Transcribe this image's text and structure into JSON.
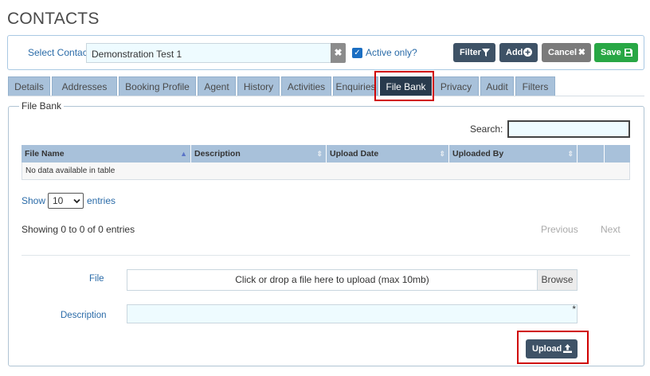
{
  "page": {
    "title": "CONTACTS"
  },
  "contact_bar": {
    "select_label": "Select Contact",
    "contact_value": "Demonstration Test 1",
    "clear_icon": "close-icon",
    "active_only_label": "Active only?",
    "active_only_checked": true,
    "buttons": {
      "filter": "Filter",
      "add": "Add",
      "cancel": "Cancel",
      "save": "Save"
    },
    "colors": {
      "dark": "#3e5266",
      "grey": "#7b7b7b",
      "green": "#28a745"
    }
  },
  "tabs": [
    {
      "label": "Details"
    },
    {
      "label": "Addresses"
    },
    {
      "label": "Booking Profile"
    },
    {
      "label": "Agent"
    },
    {
      "label": "History"
    },
    {
      "label": "Activities"
    },
    {
      "label": "Enquiries"
    },
    {
      "label": "File Bank",
      "active": true
    },
    {
      "label": "Privacy"
    },
    {
      "label": "Audit"
    },
    {
      "label": "Filters"
    }
  ],
  "file_bank": {
    "legend": "File Bank",
    "search_label": "Search:",
    "search_value": "",
    "table": {
      "columns": [
        "File Name",
        "Description",
        "Upload Date",
        "Uploaded By"
      ],
      "sorted_column": "File Name",
      "empty_message": "No data available in table"
    },
    "show_label": "Show",
    "page_size": "10",
    "entries_label": "entries",
    "info": "Showing 0 to 0 of 0 entries",
    "pagination": {
      "previous": "Previous",
      "next": "Next"
    },
    "upload": {
      "file_label": "File",
      "file_placeholder": "Click or drop a file here to upload (max 10mb)",
      "browse_label": "Browse",
      "description_label": "Description",
      "description_value": "",
      "required_marker": "*",
      "upload_button": "Upload"
    }
  },
  "highlight_color": "#d00000"
}
